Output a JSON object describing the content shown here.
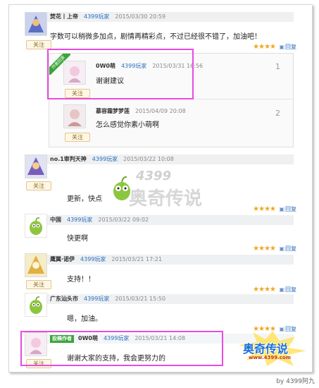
{
  "follow_label": "关注",
  "reply_label": "回复",
  "rating_stars": "★★★★",
  "source_name": "4399玩家",
  "posts": [
    {
      "user": "焚花丨上帝",
      "time": "2015/03/30 20:59",
      "content": "字数可以稍微多加点，剧情再精彩点，不过已经很不错了，加油吧！"
    },
    {
      "user": "no.1审判天神",
      "time": "2015/03/22 10:08",
      "content": "更新，快点"
    },
    {
      "user": "中国",
      "time": "2015/03/22 09:02",
      "content": "快更啊"
    },
    {
      "user": "鹰翼·诺伊",
      "time": "2015/03/21 17:21",
      "content": "支持！！"
    },
    {
      "user": "广东汕头市",
      "time": "2015/03/21 15:50",
      "content": "嗯，加油。"
    },
    {
      "user": "0W0萌",
      "time": "2015/03/21 14:08",
      "content": "谢谢大家的支持，我会更努力的"
    }
  ],
  "replies": [
    {
      "user": "0W0萌",
      "time": "2015/03/31 16:56",
      "content": "谢谢建议",
      "num": "1",
      "ribbon": "作者回复"
    },
    {
      "user": "慕容霜梦梦莲",
      "time": "2015/04/09 20:08",
      "content": "怎么感觉你素小萌啊",
      "num": "2"
    }
  ],
  "author_badge": "投稿作者",
  "watermark": {
    "top": "4399",
    "main": "奥奇传说"
  },
  "corner_logo": {
    "main": "奥奇传说",
    "url": "www.4399.com"
  },
  "signature": "by 4399阿九"
}
